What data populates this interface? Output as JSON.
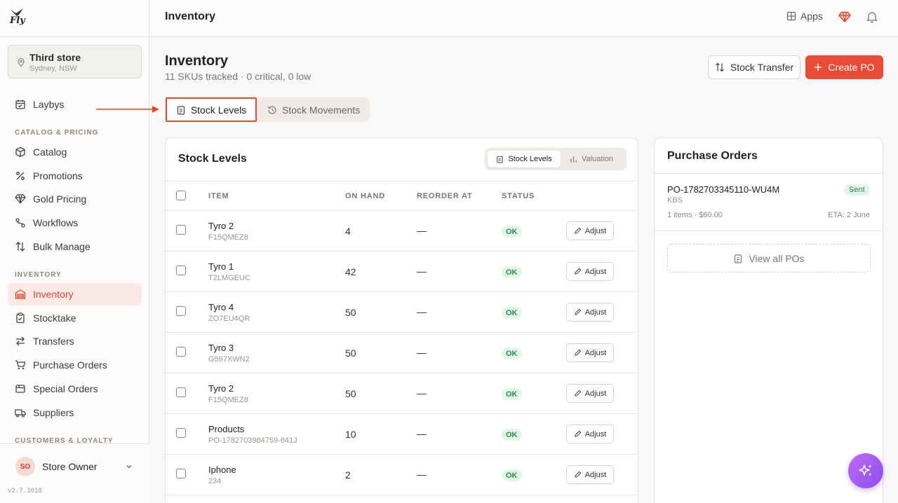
{
  "brand": {
    "logo_text": "Fly"
  },
  "store": {
    "name": "Third store",
    "location": "Sydney, NSW"
  },
  "sidebar": {
    "top_items": [
      {
        "label": "Laybys",
        "icon": "calendar-icon"
      }
    ],
    "sections": [
      {
        "title": "CATALOG & PRICING",
        "items": [
          {
            "label": "Catalog",
            "icon": "box-icon"
          },
          {
            "label": "Promotions",
            "icon": "percent-icon"
          },
          {
            "label": "Gold Pricing",
            "icon": "gem-icon"
          },
          {
            "label": "Workflows",
            "icon": "workflow-icon"
          },
          {
            "label": "Bulk Manage",
            "icon": "sort-arrows-icon"
          }
        ]
      },
      {
        "title": "INVENTORY",
        "items": [
          {
            "label": "Inventory",
            "icon": "warehouse-icon",
            "active": true
          },
          {
            "label": "Stocktake",
            "icon": "clipboard-icon"
          },
          {
            "label": "Transfers",
            "icon": "transfer-icon"
          },
          {
            "label": "Purchase Orders",
            "icon": "cart-icon"
          },
          {
            "label": "Special Orders",
            "icon": "package-icon"
          },
          {
            "label": "Suppliers",
            "icon": "truck-icon"
          }
        ]
      },
      {
        "title": "CUSTOMERS & LOYALTY",
        "items": []
      }
    ],
    "user": {
      "initials": "SO",
      "name": "Store Owner"
    },
    "version": "v2.7.1018"
  },
  "topbar": {
    "title": "Inventory",
    "apps_label": "Apps"
  },
  "page": {
    "title": "Inventory",
    "subtitle": "11 SKUs tracked · 0 critical, 0 low",
    "stock_transfer_label": "Stock Transfer",
    "create_po_label": "Create PO"
  },
  "tabs": [
    {
      "label": "Stock Levels",
      "active": true
    },
    {
      "label": "Stock Movements",
      "active": false
    }
  ],
  "stock_card": {
    "title": "Stock Levels",
    "toggle": [
      {
        "label": "Stock Levels",
        "active": true
      },
      {
        "label": "Valuation",
        "active": false
      }
    ],
    "columns": [
      "ITEM",
      "ON HAND",
      "REORDER AT",
      "STATUS"
    ],
    "adjust_label": "Adjust",
    "rows": [
      {
        "name": "Tyro 2",
        "sku": "F15QMEZ8",
        "on_hand": "4",
        "reorder_at": "—",
        "status": "OK"
      },
      {
        "name": "Tyro 1",
        "sku": "T2LMGEUC",
        "on_hand": "42",
        "reorder_at": "—",
        "status": "OK"
      },
      {
        "name": "Tyro 4",
        "sku": "ZO7EU4QR",
        "on_hand": "50",
        "reorder_at": "—",
        "status": "OK"
      },
      {
        "name": "Tyro 3",
        "sku": "G597XWN2",
        "on_hand": "50",
        "reorder_at": "—",
        "status": "OK"
      },
      {
        "name": "Tyro 2",
        "sku": "F15QMEZ8",
        "on_hand": "50",
        "reorder_at": "—",
        "status": "OK"
      },
      {
        "name": "Products",
        "sku": "PO-1782703984759-641J",
        "on_hand": "10",
        "reorder_at": "—",
        "status": "OK"
      },
      {
        "name": "Iphone",
        "sku": "234",
        "on_hand": "2",
        "reorder_at": "—",
        "status": "OK"
      }
    ]
  },
  "po_card": {
    "title": "Purchase Orders",
    "order": {
      "id": "PO-1782703345110-WU4M",
      "vendor": "KBS",
      "status": "Sent",
      "meta": "1 items · $60.00",
      "eta": "ETA: 2 June"
    },
    "view_all_label": "View all POs"
  },
  "colors": {
    "accent": "#ea4b35",
    "active_bg": "#fbe9e6",
    "ok_bg": "#e3f5e9",
    "ok_text": "#2a8f4e",
    "fab": "#a35cf0"
  }
}
